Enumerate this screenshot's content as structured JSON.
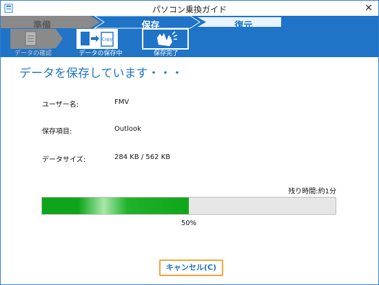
{
  "window": {
    "title": "パソコン乗換ガイド",
    "close_glyph": "✕"
  },
  "steps": [
    {
      "label": "準備"
    },
    {
      "label": "保存"
    },
    {
      "label": "復元"
    }
  ],
  "substeps": [
    {
      "label": "データの確認",
      "icon": "document-icon"
    },
    {
      "label": "データの保存中",
      "icon": "copy-file-icon"
    },
    {
      "label": "保存完了",
      "icon": "clap-hands-icon"
    }
  ],
  "substep2_icon_text": "Copy",
  "heading": "データを保存しています・・・",
  "fields": [
    {
      "label": "ユーザー名:",
      "value": "FMV"
    },
    {
      "label": "保存項目:",
      "value": "Outlook"
    },
    {
      "label": "データサイズ:",
      "value": "284 KB / 562 KB"
    }
  ],
  "remaining_time": "残り時間:約1分",
  "progress": {
    "percent_value": 50,
    "percent_text": "50%"
  },
  "cancel_button": "キャンセル(C)",
  "colors": {
    "accent": "#1f74c7",
    "progress": "#0fa51a",
    "focus": "#f2a43a"
  }
}
